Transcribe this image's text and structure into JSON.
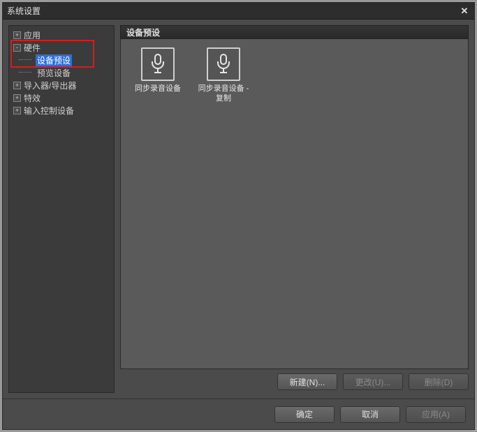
{
  "window": {
    "title": "系统设置"
  },
  "sidebar": {
    "items": [
      {
        "label": "应用",
        "expander": "+"
      },
      {
        "label": "硬件",
        "expander": "-"
      },
      {
        "label": "设备预设"
      },
      {
        "label": "预览设备"
      },
      {
        "label": "导入器/导出器",
        "expander": "+"
      },
      {
        "label": "特效",
        "expander": "+"
      },
      {
        "label": "输入控制设备",
        "expander": "+"
      }
    ]
  },
  "panel": {
    "header": "设备预设",
    "presets": [
      {
        "label": "同步录音设备"
      },
      {
        "label": "同步录音设备 - 复制"
      }
    ],
    "buttons": {
      "new": "新建(N)...",
      "change": "更改(U)...",
      "delete": "删除(D)"
    }
  },
  "footer": {
    "ok": "确定",
    "cancel": "取消",
    "apply": "应用(A)"
  }
}
